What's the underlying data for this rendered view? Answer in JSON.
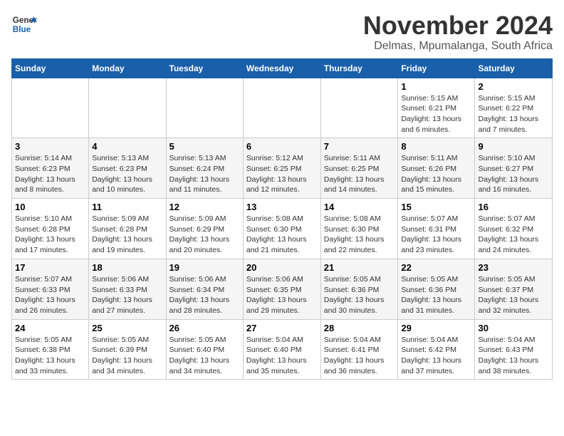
{
  "logo": {
    "line1": "General",
    "line2": "Blue"
  },
  "title": "November 2024",
  "subtitle": "Delmas, Mpumalanga, South Africa",
  "days_of_week": [
    "Sunday",
    "Monday",
    "Tuesday",
    "Wednesday",
    "Thursday",
    "Friday",
    "Saturday"
  ],
  "weeks": [
    [
      {
        "day": "",
        "info": ""
      },
      {
        "day": "",
        "info": ""
      },
      {
        "day": "",
        "info": ""
      },
      {
        "day": "",
        "info": ""
      },
      {
        "day": "",
        "info": ""
      },
      {
        "day": "1",
        "info": "Sunrise: 5:15 AM\nSunset: 6:21 PM\nDaylight: 13 hours and 6 minutes."
      },
      {
        "day": "2",
        "info": "Sunrise: 5:15 AM\nSunset: 6:22 PM\nDaylight: 13 hours and 7 minutes."
      }
    ],
    [
      {
        "day": "3",
        "info": "Sunrise: 5:14 AM\nSunset: 6:23 PM\nDaylight: 13 hours and 8 minutes."
      },
      {
        "day": "4",
        "info": "Sunrise: 5:13 AM\nSunset: 6:23 PM\nDaylight: 13 hours and 10 minutes."
      },
      {
        "day": "5",
        "info": "Sunrise: 5:13 AM\nSunset: 6:24 PM\nDaylight: 13 hours and 11 minutes."
      },
      {
        "day": "6",
        "info": "Sunrise: 5:12 AM\nSunset: 6:25 PM\nDaylight: 13 hours and 12 minutes."
      },
      {
        "day": "7",
        "info": "Sunrise: 5:11 AM\nSunset: 6:25 PM\nDaylight: 13 hours and 14 minutes."
      },
      {
        "day": "8",
        "info": "Sunrise: 5:11 AM\nSunset: 6:26 PM\nDaylight: 13 hours and 15 minutes."
      },
      {
        "day": "9",
        "info": "Sunrise: 5:10 AM\nSunset: 6:27 PM\nDaylight: 13 hours and 16 minutes."
      }
    ],
    [
      {
        "day": "10",
        "info": "Sunrise: 5:10 AM\nSunset: 6:28 PM\nDaylight: 13 hours and 17 minutes."
      },
      {
        "day": "11",
        "info": "Sunrise: 5:09 AM\nSunset: 6:28 PM\nDaylight: 13 hours and 19 minutes."
      },
      {
        "day": "12",
        "info": "Sunrise: 5:09 AM\nSunset: 6:29 PM\nDaylight: 13 hours and 20 minutes."
      },
      {
        "day": "13",
        "info": "Sunrise: 5:08 AM\nSunset: 6:30 PM\nDaylight: 13 hours and 21 minutes."
      },
      {
        "day": "14",
        "info": "Sunrise: 5:08 AM\nSunset: 6:30 PM\nDaylight: 13 hours and 22 minutes."
      },
      {
        "day": "15",
        "info": "Sunrise: 5:07 AM\nSunset: 6:31 PM\nDaylight: 13 hours and 23 minutes."
      },
      {
        "day": "16",
        "info": "Sunrise: 5:07 AM\nSunset: 6:32 PM\nDaylight: 13 hours and 24 minutes."
      }
    ],
    [
      {
        "day": "17",
        "info": "Sunrise: 5:07 AM\nSunset: 6:33 PM\nDaylight: 13 hours and 26 minutes."
      },
      {
        "day": "18",
        "info": "Sunrise: 5:06 AM\nSunset: 6:33 PM\nDaylight: 13 hours and 27 minutes."
      },
      {
        "day": "19",
        "info": "Sunrise: 5:06 AM\nSunset: 6:34 PM\nDaylight: 13 hours and 28 minutes."
      },
      {
        "day": "20",
        "info": "Sunrise: 5:06 AM\nSunset: 6:35 PM\nDaylight: 13 hours and 29 minutes."
      },
      {
        "day": "21",
        "info": "Sunrise: 5:05 AM\nSunset: 6:36 PM\nDaylight: 13 hours and 30 minutes."
      },
      {
        "day": "22",
        "info": "Sunrise: 5:05 AM\nSunset: 6:36 PM\nDaylight: 13 hours and 31 minutes."
      },
      {
        "day": "23",
        "info": "Sunrise: 5:05 AM\nSunset: 6:37 PM\nDaylight: 13 hours and 32 minutes."
      }
    ],
    [
      {
        "day": "24",
        "info": "Sunrise: 5:05 AM\nSunset: 6:38 PM\nDaylight: 13 hours and 33 minutes."
      },
      {
        "day": "25",
        "info": "Sunrise: 5:05 AM\nSunset: 6:39 PM\nDaylight: 13 hours and 34 minutes."
      },
      {
        "day": "26",
        "info": "Sunrise: 5:05 AM\nSunset: 6:40 PM\nDaylight: 13 hours and 34 minutes."
      },
      {
        "day": "27",
        "info": "Sunrise: 5:04 AM\nSunset: 6:40 PM\nDaylight: 13 hours and 35 minutes."
      },
      {
        "day": "28",
        "info": "Sunrise: 5:04 AM\nSunset: 6:41 PM\nDaylight: 13 hours and 36 minutes."
      },
      {
        "day": "29",
        "info": "Sunrise: 5:04 AM\nSunset: 6:42 PM\nDaylight: 13 hours and 37 minutes."
      },
      {
        "day": "30",
        "info": "Sunrise: 5:04 AM\nSunset: 6:43 PM\nDaylight: 13 hours and 38 minutes."
      }
    ]
  ]
}
